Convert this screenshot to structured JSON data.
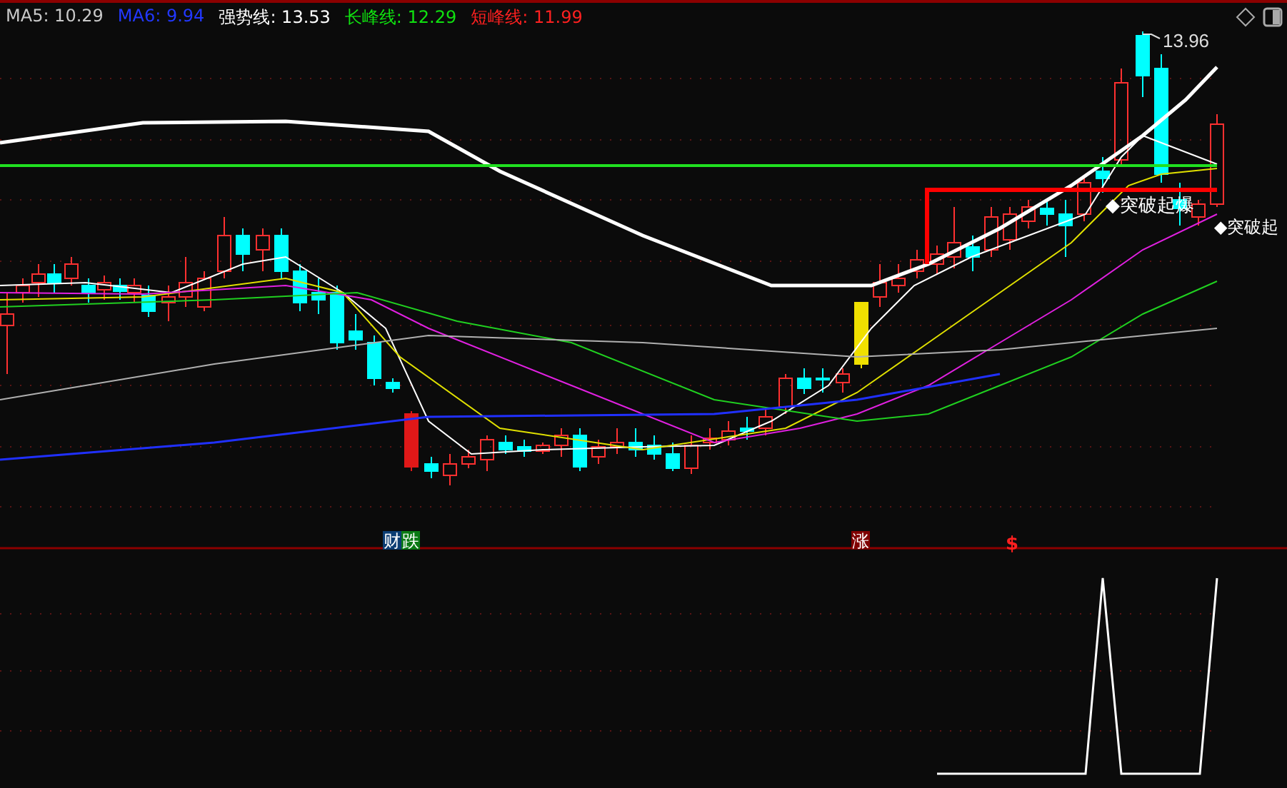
{
  "legend": [
    {
      "label": "MA5:",
      "value": "10.29",
      "color": "#c8c8c8"
    },
    {
      "label": "MA6:",
      "value": "9.94",
      "color": "#2238ff"
    },
    {
      "label": "强势线:",
      "value": "13.53",
      "color": "#ffffff"
    },
    {
      "label": "长峰线:",
      "value": "12.29",
      "color": "#10e010"
    },
    {
      "label": "短峰线:",
      "value": "11.99",
      "color": "#ff2020"
    }
  ],
  "price_marker": {
    "text": "13.96"
  },
  "signals": [
    {
      "text": "◆突破起爆"
    },
    {
      "text": "◆突破起"
    }
  ],
  "event_markers": [
    {
      "kind": "badge",
      "text": "财",
      "color": "#0b3d73"
    },
    {
      "kind": "badge",
      "text": "跌",
      "color": "#0a7a14"
    },
    {
      "kind": "badge",
      "text": "涨",
      "color": "#800000"
    },
    {
      "kind": "symbol",
      "text": "$",
      "color": "#ff2020"
    }
  ]
}
